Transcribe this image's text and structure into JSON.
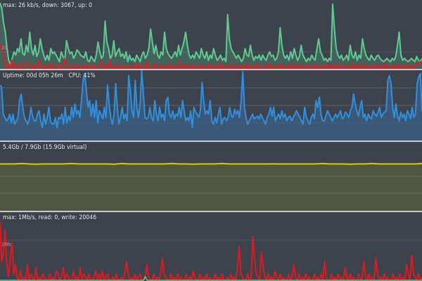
{
  "network": {
    "label": "max: 26 kb/s, down: 3067, up: 0",
    "scale_label": "10",
    "down_color": "#5ecb91",
    "up_color": "#e11b22",
    "down": [
      1.0,
      0.92,
      0.7,
      0.55,
      0.3,
      0.12,
      0.05,
      0.15,
      0.25,
      0.2,
      0.3,
      0.25,
      0.45,
      0.22,
      0.2,
      0.35,
      0.25,
      0.55,
      0.3,
      0.2,
      0.35,
      0.18,
      0.25,
      0.45,
      0.3,
      0.2,
      0.12,
      0.2,
      0.12,
      0.3,
      0.22,
      0.25,
      0.2,
      0.15,
      0.1,
      0.25,
      0.18,
      0.12,
      0.42,
      0.3,
      0.22,
      0.25,
      0.15,
      0.2,
      0.28,
      0.25,
      0.2,
      0.18,
      0.16,
      0.25,
      0.12,
      0.1,
      0.18,
      0.14,
      0.1,
      0.2,
      0.4,
      0.25,
      0.15,
      0.2,
      0.72,
      0.4,
      0.3,
      0.15,
      0.2,
      0.42,
      0.18,
      0.25,
      0.3,
      0.18,
      0.22,
      0.15,
      0.25,
      0.1,
      0.2,
      0.12,
      0.15,
      0.1,
      0.2,
      0.15,
      0.1,
      0.2,
      0.25,
      0.15,
      0.2,
      0.3,
      0.6,
      0.4,
      0.22,
      0.35,
      0.2,
      0.15,
      0.25,
      0.2,
      0.55,
      0.3,
      0.22,
      0.18,
      0.15,
      0.2,
      0.25,
      0.18,
      0.35,
      0.2,
      0.3,
      0.4,
      0.55,
      0.35,
      0.2,
      0.15,
      0.2,
      0.15,
      0.25,
      0.2,
      0.15,
      0.3,
      0.2,
      0.15,
      0.25,
      0.12,
      0.2,
      0.15,
      0.3,
      0.2,
      0.12,
      0.15,
      0.2,
      0.12,
      0.15,
      0.1,
      0.82,
      0.45,
      0.3,
      0.25,
      0.2,
      0.15,
      0.2,
      0.15,
      0.1,
      0.15,
      0.3,
      0.2,
      0.18,
      0.35,
      0.2,
      0.12,
      0.18,
      0.15,
      0.2,
      0.12,
      0.2,
      0.15,
      0.12,
      0.2,
      0.25,
      0.18,
      0.2,
      0.12,
      0.15,
      0.25,
      0.62,
      0.35,
      0.2,
      0.15,
      0.2,
      0.12,
      0.25,
      0.15,
      0.3,
      0.2,
      0.12,
      0.18,
      0.35,
      0.2,
      0.15,
      0.1,
      0.15,
      0.12,
      0.2,
      0.15,
      0.12,
      0.3,
      0.45,
      0.25,
      0.2,
      0.12,
      0.15,
      0.1,
      0.15,
      0.12,
      0.98,
      0.6,
      0.3,
      0.2,
      0.15,
      0.2,
      0.12,
      0.15,
      0.2,
      0.12,
      0.35,
      0.2,
      0.15,
      0.25,
      0.12,
      0.2,
      0.15,
      0.45,
      0.3,
      0.2,
      0.15,
      0.12,
      0.2,
      0.15,
      0.12,
      0.18,
      0.2,
      0.15,
      0.12,
      0.1,
      0.12,
      0.15,
      0.12,
      0.1,
      0.15,
      0.12,
      0.18,
      0.35,
      0.55,
      0.2,
      0.12,
      0.15,
      0.12,
      0.1,
      0.12,
      0.15,
      0.12,
      0.1,
      0.18,
      0.12,
      0.1,
      0.15
    ],
    "up": [
      0.3,
      0.35,
      0.25,
      0.05,
      0.0,
      0.08,
      0.0,
      0.12,
      0.0,
      0.05,
      0.0,
      0.0,
      0.08,
      0.0,
      0.0,
      0.05,
      0.1,
      0.04,
      0.0,
      0.0,
      0.06,
      0.0,
      0.0,
      0.12,
      0.02,
      0.0,
      0.0,
      0.05,
      0.0,
      0.0,
      0.08,
      0.0,
      0.0,
      0.03,
      0.0,
      0.06,
      0.0,
      0.0,
      0.15,
      0.05,
      0.0,
      0.0,
      0.04,
      0.0,
      0.0,
      0.06,
      0.0,
      0.0,
      0.03,
      0.0,
      0.05,
      0.0,
      0.0,
      0.08,
      0.0,
      0.0,
      0.04,
      0.0,
      0.0,
      0.06,
      0.1,
      0.0,
      0.0,
      0.05,
      0.0,
      0.12,
      0.0,
      0.0,
      0.04,
      0.0,
      0.0,
      0.06,
      0.0,
      0.0,
      0.03,
      0.0,
      0.05,
      0.0,
      0.0,
      0.04,
      0.0,
      0.08,
      0.0,
      0.0,
      0.05,
      0.0,
      0.0,
      0.1,
      0.0,
      0.0,
      0.04,
      0.0,
      0.06,
      0.0,
      0.0,
      0.05,
      0.0,
      0.0,
      0.04,
      0.0,
      0.07,
      0.0,
      0.0,
      0.05,
      0.0,
      0.0,
      0.1,
      0.0,
      0.0,
      0.05,
      0.0,
      0.04,
      0.0,
      0.0,
      0.06,
      0.0,
      0.0,
      0.03,
      0.0,
      0.05,
      0.0,
      0.0,
      0.04,
      0.0,
      0.06,
      0.0,
      0.0,
      0.05,
      0.0,
      0.0,
      0.08,
      0.0,
      0.0,
      0.04,
      0.0,
      0.05,
      0.0,
      0.0,
      0.06,
      0.0,
      0.0,
      0.04,
      0.0,
      0.05,
      0.0,
      0.0,
      0.07,
      0.0,
      0.0,
      0.04,
      0.0,
      0.06,
      0.0,
      0.0,
      0.05,
      0.0,
      0.0,
      0.04,
      0.0,
      0.08,
      0.0,
      0.0,
      0.05,
      0.0,
      0.0,
      0.06,
      0.0,
      0.04,
      0.0,
      0.0,
      0.05,
      0.0,
      0.0,
      0.07,
      0.0,
      0.0,
      0.04,
      0.0,
      0.05,
      0.0,
      0.0,
      0.06,
      0.0,
      0.0,
      0.04,
      0.0,
      0.06,
      0.0,
      0.0,
      0.05,
      0.0,
      0.0,
      0.04,
      0.0,
      0.07,
      0.0,
      0.0,
      0.05,
      0.0,
      0.0,
      0.06,
      0.0,
      0.04,
      0.0,
      0.0,
      0.05,
      0.0,
      0.0,
      0.07,
      0.0,
      0.0,
      0.04,
      0.0,
      0.06,
      0.0,
      0.0,
      0.05,
      0.0,
      0.0,
      0.04,
      0.0,
      0.06,
      0.0,
      0.0,
      0.05,
      0.0,
      0.0,
      0.08,
      0.0,
      0.0,
      0.04,
      0.0,
      0.05,
      0.0,
      0.0,
      0.06,
      0.0,
      0.0,
      0.04,
      0.0,
      0.07,
      0.0,
      0.0,
      0.05,
      0.0,
      0.0,
      0.06,
      0.08,
      0.1,
      0.04
    ]
  },
  "cpu": {
    "label": "Uptime: 00d 05h 26m   CPU: 41%",
    "line_color": "#2f90e0",
    "fill_color": "#3c5f86",
    "usage": [
      0.78,
      0.75,
      0.35,
      0.3,
      0.25,
      0.28,
      0.35,
      0.22,
      0.35,
      0.2,
      0.25,
      0.3,
      0.55,
      0.65,
      0.45,
      0.3,
      0.25,
      0.2,
      0.28,
      0.45,
      0.32,
      0.25,
      0.25,
      0.35,
      0.4,
      0.25,
      0.15,
      0.35,
      0.2,
      0.3,
      0.45,
      0.25,
      0.2,
      0.2,
      0.3,
      0.15,
      0.3,
      0.28,
      0.35,
      0.2,
      0.45,
      0.22,
      0.32,
      0.25,
      0.45,
      0.3,
      0.5,
      0.35,
      0.4,
      0.3,
      0.55,
      0.85,
      0.95,
      0.7,
      0.45,
      0.55,
      0.32,
      0.5,
      0.3,
      0.55,
      0.22,
      0.4,
      0.35,
      0.28,
      0.45,
      0.3,
      0.78,
      0.5,
      0.3,
      0.2,
      0.35,
      0.8,
      0.45,
      0.2,
      0.3,
      0.45,
      0.28,
      0.35,
      0.25,
      0.92,
      0.7,
      0.4,
      0.3,
      0.85,
      0.45,
      0.3,
      0.5,
      1.0,
      0.65,
      0.3,
      0.28,
      0.3,
      0.45,
      0.3,
      0.25,
      0.55,
      0.35,
      0.25,
      0.45,
      0.3,
      0.35,
      0.25,
      0.55,
      0.6,
      0.35,
      0.3,
      0.4,
      0.28,
      0.35,
      0.32,
      0.45,
      0.3,
      0.55,
      0.4,
      0.25,
      0.3,
      0.25,
      0.4,
      0.15,
      0.45,
      0.38,
      0.35,
      0.3,
      0.4,
      0.82,
      0.55,
      0.35,
      0.4,
      0.35,
      0.55,
      0.25,
      0.2,
      0.3,
      0.22,
      0.35,
      0.45,
      0.2,
      0.28,
      0.3,
      0.25,
      0.3,
      0.45,
      0.32,
      0.3,
      0.42,
      0.35,
      0.4,
      0.3,
      0.55,
      0.98,
      0.45,
      0.3,
      0.2,
      0.25,
      0.3,
      0.35,
      0.28,
      0.3,
      0.32,
      0.28,
      0.35,
      0.3,
      0.25,
      0.2,
      0.3,
      0.35,
      0.45,
      0.32,
      0.45,
      0.25,
      0.3,
      0.35,
      0.28,
      0.4,
      0.3,
      0.35,
      0.25,
      0.3,
      0.32,
      0.25,
      0.3,
      0.35,
      0.4,
      0.35,
      0.3,
      0.25,
      0.2,
      0.45,
      0.3,
      0.25,
      0.2,
      0.3,
      0.35,
      0.28,
      0.55,
      0.45,
      0.6,
      0.35,
      0.25,
      0.25,
      0.32,
      0.4,
      0.35,
      0.3,
      0.25,
      0.3,
      0.35,
      0.3,
      0.35,
      0.4,
      0.28,
      0.3,
      0.38,
      0.35,
      0.3,
      0.4,
      0.45,
      0.65,
      0.5,
      0.4,
      0.32,
      0.45,
      0.55,
      0.3,
      0.35,
      0.25,
      0.35,
      0.3,
      0.28,
      0.4,
      0.35,
      0.32,
      0.38,
      0.45,
      0.3,
      0.35,
      0.38,
      0.4,
      0.85,
      0.92,
      0.8,
      0.45,
      0.3,
      0.5,
      0.32,
      0.25,
      0.38,
      0.3,
      0.35,
      0.25,
      0.4,
      0.35,
      0.28,
      0.45,
      0.3,
      0.35,
      0.8,
      0.9,
      0.95,
      0.4
    ]
  },
  "memory": {
    "label": "5.4Gb / 7.9Gb (15.9Gb virtual)",
    "line_color": "#d8cc00",
    "fill_color": "#525741",
    "usage_start": 0.68,
    "usage_end": 0.68
  },
  "disk": {
    "label": "max: 1Mb/s, read: 0, write: 20046",
    "scale_label": "1Mb",
    "write_color": "#e3171d",
    "read_color": "#5ecb91",
    "write": [
      0.95,
      0.3,
      0.45,
      0.8,
      0.25,
      0.05,
      0.35,
      0.6,
      0.1,
      0.25,
      0.05,
      0.0,
      0.15,
      0.0,
      0.05,
      0.0,
      0.25,
      0.0,
      0.1,
      0.05,
      0.0,
      0.2,
      0.0,
      0.05,
      0.0,
      0.1,
      0.05,
      0.0,
      0.0,
      0.1,
      0.0,
      0.05,
      0.0,
      0.15,
      0.1,
      0.0,
      0.05,
      0.2,
      0.0,
      0.1,
      0.05,
      0.0,
      0.0,
      0.15,
      0.0,
      0.05,
      0.0,
      0.2,
      0.0,
      0.1,
      0.05,
      0.0,
      0.1,
      0.0,
      0.0,
      0.05,
      0.15,
      0.0,
      0.1,
      0.0,
      0.15,
      0.0,
      0.05,
      0.1,
      0.0,
      0.0,
      0.05,
      0.0,
      0.1,
      0.0,
      0.0,
      0.05,
      0.0,
      0.1,
      0.3,
      0.1,
      0.0,
      0.05,
      0.0,
      0.1,
      0.0,
      0.05,
      0.1,
      0.0,
      0.0,
      0.05,
      0.25,
      0.05,
      0.0,
      0.0,
      0.1,
      0.0,
      0.05,
      0.0,
      0.1,
      0.35,
      0.1,
      0.05,
      0.0,
      0.0,
      0.1,
      0.0,
      0.05,
      0.0,
      0.1,
      0.0,
      0.05,
      0.0,
      0.0,
      0.1,
      0.0,
      0.05,
      0.0,
      0.15,
      0.05,
      0.0,
      0.0,
      0.1,
      0.0,
      0.05,
      0.0,
      0.1,
      0.0,
      0.05,
      0.0,
      0.0,
      0.1,
      0.0,
      0.05,
      0.0,
      0.1,
      0.0,
      0.0,
      0.05,
      0.0,
      0.1,
      0.0,
      0.05,
      0.0,
      0.2,
      0.55,
      0.1,
      0.05,
      0.0,
      0.0,
      0.1,
      0.0,
      0.05,
      0.7,
      0.35,
      0.1,
      0.05,
      0.0,
      0.45,
      0.2,
      0.05,
      0.0,
      0.1,
      0.0,
      0.05,
      0.0,
      0.15,
      0.05,
      0.0,
      0.1,
      0.0,
      0.05,
      0.0,
      0.0,
      0.1,
      0.0,
      0.05,
      0.25,
      0.05,
      0.0,
      0.1,
      0.0,
      0.05,
      0.0,
      0.1,
      0.0,
      0.05,
      0.0,
      0.0,
      0.1,
      0.0,
      0.05,
      0.0,
      0.1,
      0.0,
      0.3,
      0.05,
      0.0,
      0.0,
      0.1,
      0.0,
      0.05,
      0.0,
      0.1,
      0.0,
      0.05,
      0.0,
      0.2,
      0.05,
      0.0,
      0.1,
      0.0,
      0.05,
      0.0,
      0.0,
      0.1,
      0.0,
      0.05,
      0.3,
      0.05,
      0.0,
      0.1,
      0.0,
      0.05,
      0.0,
      0.35,
      0.1,
      0.0,
      0.05,
      0.0,
      0.1,
      0.0,
      0.05,
      0.0,
      0.0,
      0.1,
      0.0,
      0.05,
      0.0,
      0.1,
      0.0,
      0.05,
      0.0,
      0.25,
      0.1,
      0.0,
      0.4,
      0.1,
      0.05,
      0.0,
      0.1,
      0.0,
      0.05
    ],
    "read": [
      0.0,
      0.0,
      0.0,
      0.0,
      0.0,
      0.0,
      0.0,
      0.0,
      0.0,
      0.0,
      0.0,
      0.0,
      0.0,
      0.0,
      0.0,
      0.0,
      0.0,
      0.0,
      0.0,
      0.0,
      0.0,
      0.0,
      0.0,
      0.0,
      0.0,
      0.0,
      0.0,
      0.0,
      0.0,
      0.0,
      0.0,
      0.0,
      0.0,
      0.0,
      0.0,
      0.0,
      0.0,
      0.0,
      0.0,
      0.0,
      0.0,
      0.0,
      0.0,
      0.0,
      0.0,
      0.0,
      0.0,
      0.0,
      0.0,
      0.0,
      0.0,
      0.0,
      0.0,
      0.0,
      0.0,
      0.0,
      0.0,
      0.0,
      0.0,
      0.0,
      0.0,
      0.0,
      0.0,
      0.0,
      0.0,
      0.0,
      0.0,
      0.0,
      0.0,
      0.0,
      0.0,
      0.0,
      0.0,
      0.0,
      0.0,
      0.0,
      0.0,
      0.0,
      0.0,
      0.0,
      0.0,
      0.0,
      0.0,
      0.0,
      0.0,
      0.06,
      0.0,
      0.0,
      0.0,
      0.0,
      0.0,
      0.0,
      0.0,
      0.0,
      0.0,
      0.0,
      0.0,
      0.0,
      0.0,
      0.0,
      0.0,
      0.0,
      0.0,
      0.0,
      0.0,
      0.0,
      0.0,
      0.0,
      0.0,
      0.0,
      0.0,
      0.0,
      0.0,
      0.0,
      0.0,
      0.0,
      0.0,
      0.0,
      0.0,
      0.0,
      0.0,
      0.0,
      0.0,
      0.0,
      0.0,
      0.0,
      0.0,
      0.0,
      0.0,
      0.0,
      0.0,
      0.0,
      0.0,
      0.0,
      0.0,
      0.0,
      0.0,
      0.0,
      0.0,
      0.0,
      0.0,
      0.0,
      0.0,
      0.0,
      0.0,
      0.0,
      0.0,
      0.0,
      0.0,
      0.0,
      0.0,
      0.0,
      0.0,
      0.0,
      0.0,
      0.0,
      0.0,
      0.0,
      0.0,
      0.0,
      0.0,
      0.0,
      0.0,
      0.0,
      0.0,
      0.0,
      0.0,
      0.0,
      0.0,
      0.0,
      0.0,
      0.0,
      0.0,
      0.0,
      0.0,
      0.0,
      0.0,
      0.0,
      0.0,
      0.0,
      0.0,
      0.0,
      0.0,
      0.0,
      0.0,
      0.0,
      0.0,
      0.0,
      0.0,
      0.0,
      0.0,
      0.0,
      0.0,
      0.0,
      0.0,
      0.0,
      0.0,
      0.0,
      0.0,
      0.0,
      0.0,
      0.0,
      0.0,
      0.0,
      0.0,
      0.0,
      0.0,
      0.0,
      0.0,
      0.0,
      0.0,
      0.0,
      0.0,
      0.0,
      0.0,
      0.0,
      0.0,
      0.0,
      0.0,
      0.0,
      0.0,
      0.0,
      0.0,
      0.0,
      0.0,
      0.0,
      0.0,
      0.0,
      0.0,
      0.0,
      0.0,
      0.0,
      0.0,
      0.0,
      0.0,
      0.0,
      0.0,
      0.0,
      0.0,
      0.0,
      0.0,
      0.0,
      0.0,
      0.0,
      0.0,
      0.0,
      0.0,
      0.0
    ]
  }
}
